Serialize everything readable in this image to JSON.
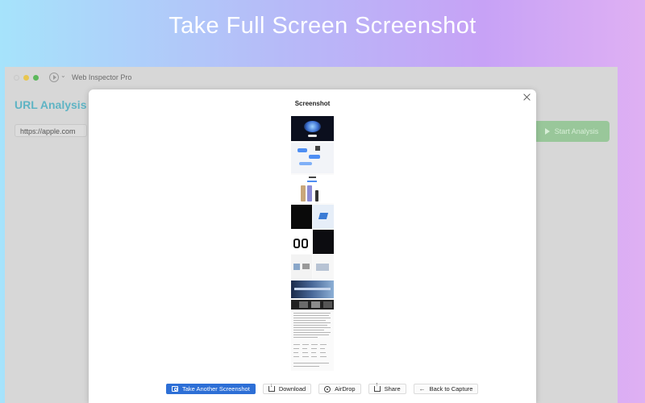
{
  "hero": {
    "title": "Take Full Screen Screenshot"
  },
  "app": {
    "name": "Web Inspector Pro",
    "heading": "URL Analysis",
    "url_value": "https://apple.com",
    "start_button": "Start Analysis"
  },
  "modal": {
    "title": "Screenshot",
    "actions": {
      "take_another": "Take Another Screenshot",
      "download": "Download",
      "airdrop": "AirDrop",
      "share": "Share",
      "back": "Back to Capture"
    }
  },
  "icons": {
    "close": "close-icon",
    "camera": "camera-icon",
    "download": "download-icon",
    "airdrop": "airdrop-icon",
    "share": "share-icon",
    "back": "arrow-left-icon",
    "play": "play-icon"
  },
  "colors": {
    "primary_button": "#2d6fd6",
    "heading_accent": "#5fb4c4",
    "start_button": "#99c79a"
  }
}
